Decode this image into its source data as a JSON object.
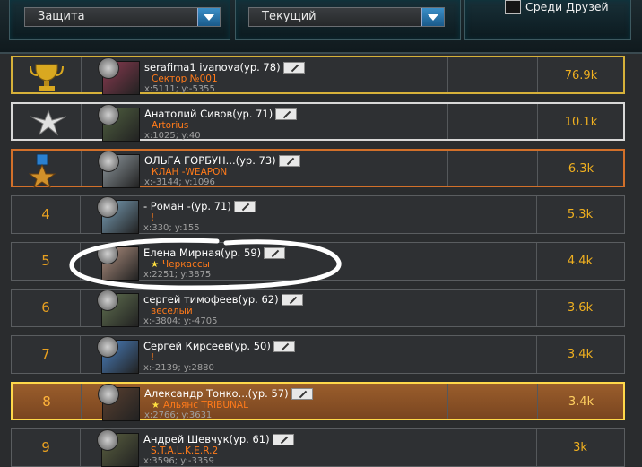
{
  "filters": {
    "category": "Защита",
    "period": "Текущий",
    "friends_only_label": "Среди Друзей"
  },
  "rows": [
    {
      "rank": "",
      "medal": "gold",
      "name": "serafima1 ivanova(ур. 78)",
      "clan": "Сектор №001",
      "star": false,
      "coords": "x:5111; y:-5355",
      "score": "76.9k",
      "style": "gold",
      "avatar_color": "#8a3a50"
    },
    {
      "rank": "",
      "medal": "silver",
      "name": "Анатолий Сивов(ур. 71)",
      "clan": "Artorius",
      "star": false,
      "coords": "x:1025; y:40",
      "score": "10.1k",
      "style": "silver",
      "avatar_color": "#506040"
    },
    {
      "rank": "",
      "medal": "bronze",
      "name": "ОЛЬГА ГОРБУН...(ур. 73)",
      "clan": "КЛАН -WEAPON",
      "star": false,
      "coords": "x:-3144; y:1096",
      "score": "6.3k",
      "style": "bronze",
      "avatar_color": "#909aa0"
    },
    {
      "rank": "4",
      "medal": "",
      "name": "- Роман -(ур. 71)",
      "clan": "!",
      "star": false,
      "coords": "x:330; y:155",
      "score": "5.3k",
      "style": "",
      "avatar_color": "#7aa0b8"
    },
    {
      "rank": "5",
      "medal": "",
      "name": "Елена Мирная(ур. 59)",
      "clan": "Черкассы",
      "star": true,
      "coords": "x:2251; y:3875",
      "score": "4.4k",
      "style": "",
      "avatar_color": "#b09080"
    },
    {
      "rank": "6",
      "medal": "",
      "name": "сергей тимофеев(ур. 62)",
      "clan": "весёлый",
      "star": false,
      "coords": "x:-3804; y:-4705",
      "score": "3.6k",
      "style": "",
      "avatar_color": "#607050"
    },
    {
      "rank": "7",
      "medal": "",
      "name": "Сергей Кирсеев(ур. 50)",
      "clan": "!",
      "star": false,
      "coords": "x:-2139; y:2880",
      "score": "3.4k",
      "style": "",
      "avatar_color": "#4a80c0"
    },
    {
      "rank": "8",
      "medal": "",
      "name": "Александр Тонко...(ур. 57)",
      "clan": "Альянс TRIBUNAL",
      "star": true,
      "coords": "x:2766; y:3631",
      "score": "3.4k",
      "style": "mine",
      "avatar_color": "#5a4030"
    },
    {
      "rank": "9",
      "medal": "",
      "name": "Андрей Шевчук(ур. 61)",
      "clan": "S.T.A.L.K.E.R.2",
      "star": false,
      "coords": "x:3596; y:-3359",
      "score": "3k",
      "style": "",
      "avatar_color": "#5a6040"
    }
  ]
}
